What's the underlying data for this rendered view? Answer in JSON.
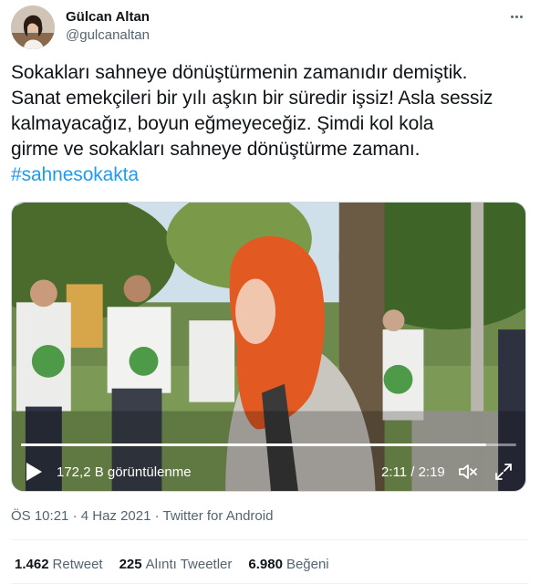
{
  "user": {
    "display_name": "Gülcan Altan",
    "handle": "@gulcanaltan"
  },
  "tweet": {
    "lines": [
      "Sokakları sahneye dönüştürmenin zamanıdır demiştik.",
      "Sanat emekçileri bir yılı aşkın bir süredir işsiz! Asla sessiz",
      "kalmayacağız, boyun eğmeyeceğiz. Şimdi kol kola",
      "girme ve sokakları sahneye dönüştürme zamanı."
    ],
    "hashtag": "#sahnesokakta"
  },
  "video": {
    "views": "172,2 B görüntülenme",
    "time": "2:11 / 2:19",
    "progress_fraction": 0.94
  },
  "meta": {
    "time": "ÖS 10:21",
    "separator": "·",
    "date": "4 Haz 2021",
    "source": "Twitter for Android"
  },
  "stats": {
    "retweets_count": "1.462",
    "retweets_label": "Retweet",
    "quotes_count": "225",
    "quotes_label": "Alıntı Tweetler",
    "likes_count": "6.980",
    "likes_label": "Beğeni"
  },
  "colors": {
    "link": "#1d9bf0",
    "secondary_text": "#536471",
    "primary_text": "#0f1419"
  },
  "icons": [
    "more-icon",
    "play-icon",
    "volume-icon",
    "fullscreen-icon"
  ]
}
